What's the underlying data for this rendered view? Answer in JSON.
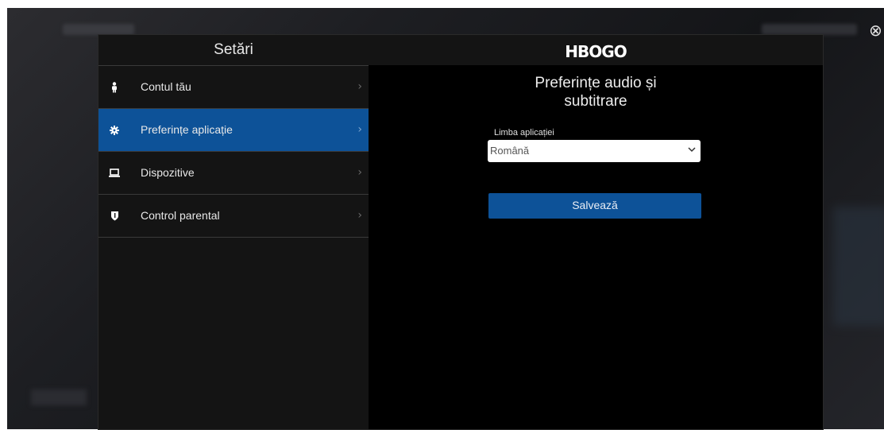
{
  "header": {
    "logo": "HBOGO"
  },
  "sidebar": {
    "title": "Setări",
    "items": [
      {
        "label": "Contul tău",
        "icon": "person-icon",
        "active": false
      },
      {
        "label": "Preferințe aplicație",
        "icon": "gear-icon",
        "active": true
      },
      {
        "label": "Dispozitive",
        "icon": "laptop-icon",
        "active": false
      },
      {
        "label": "Control parental",
        "icon": "shield-icon",
        "active": false
      }
    ]
  },
  "main": {
    "title_line1": "Preferințe audio și",
    "title_line2": "subtitrare",
    "language_label": "Limba aplicației",
    "language_value": "Română",
    "save_label": "Salvează"
  },
  "colors": {
    "accent": "#0d5298",
    "panel": "#141414",
    "background": "#000000"
  },
  "close_icon": "close-circle-icon"
}
